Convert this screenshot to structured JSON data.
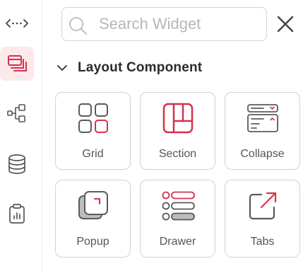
{
  "colors": {
    "accent": "#d6314c",
    "icon_gray": "#5b5b5b",
    "active_bg": "#fde8ec"
  },
  "rail": {
    "items": [
      {
        "icon": "expand-horizontal-icon",
        "active": false
      },
      {
        "icon": "layers-icon",
        "active": true
      },
      {
        "icon": "tree-structure-icon",
        "active": false
      },
      {
        "icon": "database-icon",
        "active": false
      },
      {
        "icon": "clipboard-chart-icon",
        "active": false
      }
    ]
  },
  "search": {
    "placeholder": "Search Widget",
    "value": ""
  },
  "section": {
    "title": "Layout Component",
    "expanded": true
  },
  "widgets": [
    {
      "label": "Grid",
      "icon": "grid-icon"
    },
    {
      "label": "Section",
      "icon": "section-icon"
    },
    {
      "label": "Collapse",
      "icon": "collapse-icon"
    },
    {
      "label": "Popup",
      "icon": "popup-icon"
    },
    {
      "label": "Drawer",
      "icon": "drawer-icon"
    },
    {
      "label": "Tabs",
      "icon": "tabs-icon"
    }
  ]
}
